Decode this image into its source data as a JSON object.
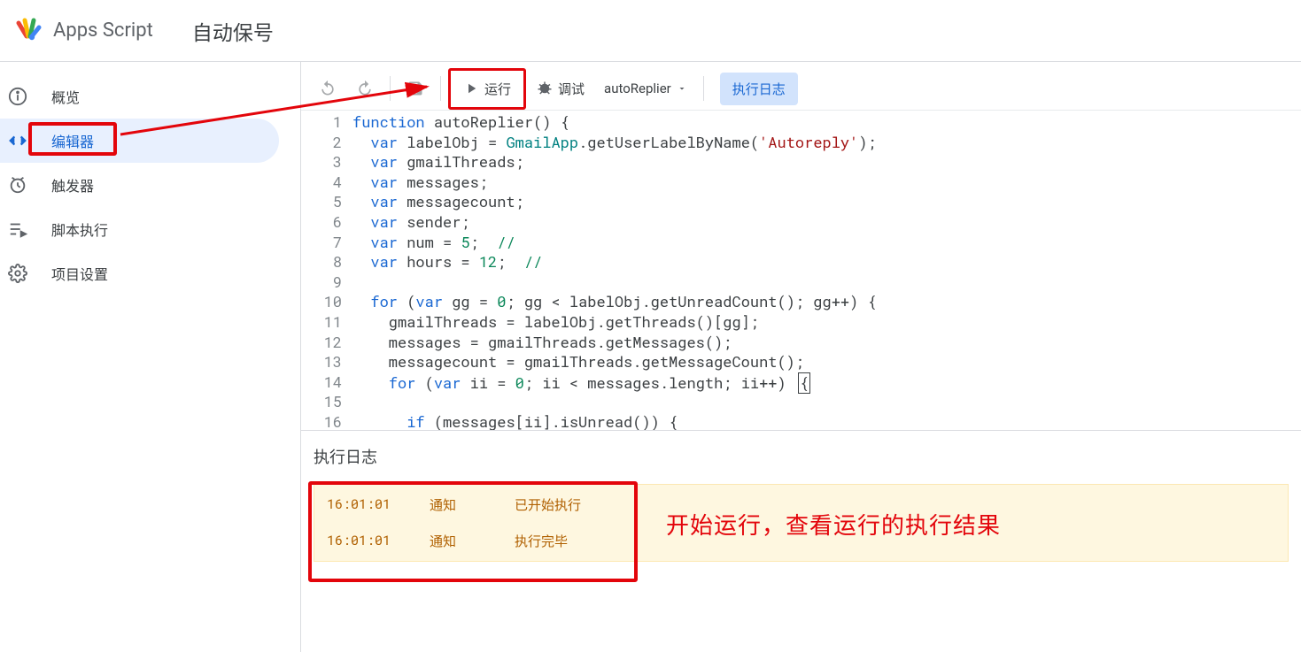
{
  "header": {
    "appTitle": "Apps Script",
    "projectTitle": "自动保号"
  },
  "sidebar": {
    "items": [
      {
        "icon": "overview",
        "label": "概览"
      },
      {
        "icon": "editor",
        "label": "编辑器"
      },
      {
        "icon": "triggers",
        "label": "触发器"
      },
      {
        "icon": "executions",
        "label": "脚本执行"
      },
      {
        "icon": "settings",
        "label": "项目设置"
      }
    ]
  },
  "toolbar": {
    "run": "运行",
    "debug": "调试",
    "fnName": "autoReplier",
    "logBtn": "执行日志"
  },
  "code": {
    "lines": [
      [
        [
          "k-blue",
          "function"
        ],
        [
          "",
          " autoReplier() {"
        ]
      ],
      [
        [
          "",
          "  "
        ],
        [
          "k-blue",
          "var"
        ],
        [
          "",
          " labelObj = "
        ],
        [
          "k-teal",
          "GmailApp"
        ],
        [
          "",
          ".getUserLabelByName("
        ],
        [
          "k-red",
          "'Autoreply'"
        ],
        [
          "",
          ");"
        ]
      ],
      [
        [
          "",
          "  "
        ],
        [
          "k-blue",
          "var"
        ],
        [
          "",
          " gmailThreads;"
        ]
      ],
      [
        [
          "",
          "  "
        ],
        [
          "k-blue",
          "var"
        ],
        [
          "",
          " messages;"
        ]
      ],
      [
        [
          "",
          "  "
        ],
        [
          "k-blue",
          "var"
        ],
        [
          "",
          " messagecount;"
        ]
      ],
      [
        [
          "",
          "  "
        ],
        [
          "k-blue",
          "var"
        ],
        [
          "",
          " sender;"
        ]
      ],
      [
        [
          "",
          "  "
        ],
        [
          "k-blue",
          "var"
        ],
        [
          "",
          " num = "
        ],
        [
          "k-green",
          "5"
        ],
        [
          "",
          ";  "
        ],
        [
          "k-green",
          "//"
        ]
      ],
      [
        [
          "",
          "  "
        ],
        [
          "k-blue",
          "var"
        ],
        [
          "",
          " hours = "
        ],
        [
          "k-green",
          "12"
        ],
        [
          "",
          ";  "
        ],
        [
          "k-green",
          "//"
        ]
      ],
      [
        [
          "",
          ""
        ]
      ],
      [
        [
          "",
          "  "
        ],
        [
          "k-blue",
          "for"
        ],
        [
          "",
          " ("
        ],
        [
          "k-blue",
          "var"
        ],
        [
          "",
          " gg = "
        ],
        [
          "k-green",
          "0"
        ],
        [
          "",
          "; gg < labelObj.getUnreadCount(); gg++) {"
        ]
      ],
      [
        [
          "",
          "    gmailThreads = labelObj.getThreads()[gg];"
        ]
      ],
      [
        [
          "",
          "    messages = gmailThreads.getMessages();"
        ]
      ],
      [
        [
          "",
          "    messagecount = gmailThreads.getMessageCount();"
        ]
      ],
      [
        [
          "",
          "    "
        ],
        [
          "k-blue",
          "for"
        ],
        [
          "",
          " ("
        ],
        [
          "k-blue",
          "var"
        ],
        [
          "",
          " ii = "
        ],
        [
          "k-green",
          "0"
        ],
        [
          "",
          "; ii < messages.length; ii++) "
        ],
        [
          "cursor",
          "{"
        ]
      ],
      [
        [
          "",
          ""
        ]
      ],
      [
        [
          "",
          "      "
        ],
        [
          "k-blue",
          "if"
        ],
        [
          "",
          " (messages[ii].isUnread()) {"
        ]
      ]
    ]
  },
  "logPanel": {
    "title": "执行日志",
    "rows": [
      {
        "time": "16:01:01",
        "type": "通知",
        "msg": "已开始执行"
      },
      {
        "time": "16:01:01",
        "type": "通知",
        "msg": "执行完毕"
      }
    ]
  },
  "callout": "开始运行，查看运行的执行结果"
}
